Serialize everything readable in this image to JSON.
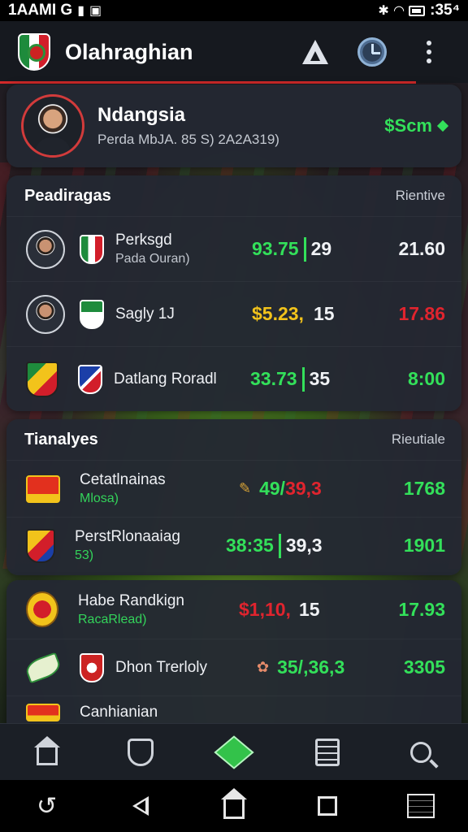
{
  "status_bar": {
    "left_text": "1AAMI G",
    "time": ":35⁴"
  },
  "app_bar": {
    "title": "Olahraghian"
  },
  "profile": {
    "name": "Ndangsia",
    "subtitle": "Perda MbJA. 85 S) 2A2A319)",
    "value": "$Scm"
  },
  "section1": {
    "title": "Peadiragas",
    "right_label": "Rientive",
    "rows": [
      {
        "name": "Perksgd",
        "sub": "Pada Ouran)",
        "value": "93.75",
        "secondary": "29",
        "last": "21.60",
        "value_color": "green",
        "last_color": "white"
      },
      {
        "name": "Sagly 1J",
        "sub": "",
        "value": "$5.23,",
        "secondary": "15",
        "last": "17.86",
        "value_color": "yellow",
        "last_color": "red"
      },
      {
        "name": "Datlang Roradl",
        "sub": "",
        "value": "33.73",
        "secondary": "35",
        "last": "8:00",
        "value_color": "green",
        "last_color": "green"
      }
    ]
  },
  "section2": {
    "title": "Tianalyes",
    "right_label": "Rieutiale",
    "rows": [
      {
        "name": "Cetatlnainas",
        "sub": "Mlosa)",
        "value": "49/",
        "value2": "39,3",
        "last": "1768"
      },
      {
        "name": "PerstRlonaaiag",
        "sub": "53)",
        "value": "38:35",
        "secondary": "39,3",
        "last": "1901"
      }
    ]
  },
  "section3": {
    "rows": [
      {
        "name": "Habe Randkign",
        "sub": "RacaRlead)",
        "value": "$1,10,",
        "secondary": "15",
        "last": "17.93"
      },
      {
        "name": "Dhon Trerloly",
        "sub": "",
        "value": "35/,",
        "value2": "36,3",
        "last": "3305"
      },
      {
        "name": "Canhianian",
        "sub": "",
        "value": "",
        "secondary": "",
        "last": ""
      }
    ]
  },
  "colors": {
    "accent_green": "#33e05a",
    "accent_red": "#d42a2a",
    "accent_yellow": "#f2c31b"
  },
  "icons": {
    "app_bar": [
      "shield-logo-icon",
      "triangle-icon",
      "clock-icon",
      "more-vert-icon"
    ],
    "bottom_nav": [
      "home-icon",
      "shield-icon",
      "cube-icon",
      "document-icon",
      "search-icon"
    ],
    "system_nav": [
      "back-icon",
      "triangle-back-icon",
      "home-icon",
      "square-icon",
      "chart-icon"
    ]
  }
}
